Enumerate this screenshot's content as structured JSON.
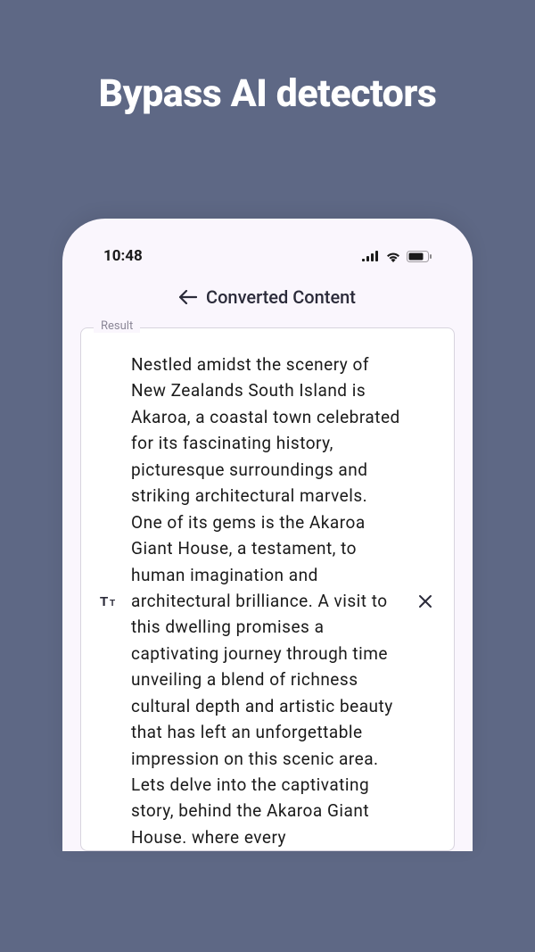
{
  "hero": {
    "title": "Bypass AI detectors"
  },
  "statusBar": {
    "time": "10:48"
  },
  "header": {
    "title": "Converted Content"
  },
  "result": {
    "label": "Result",
    "body": "Nestled amidst the scenery of New Zealands South Island is Akaroa, a coastal town celebrated for its fascinating history, picturesque surroundings and striking architectural marvels. One of its gems is the Akaroa Giant House, a testament, to human imagination and architectural brilliance. A visit to this dwelling promises a captivating journey through time unveiling a blend of richness cultural depth and artistic beauty that has left an unforgettable impression on this scenic area. Lets delve into the captivating story, behind the Akaroa Giant House. where every"
  }
}
